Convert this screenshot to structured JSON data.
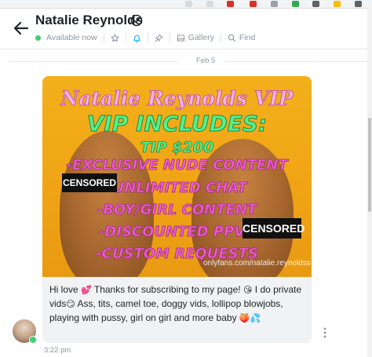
{
  "header": {
    "name": "Natalie Reynolds",
    "status": "Available now",
    "gallery_label": "Gallery",
    "find_label": "Find"
  },
  "conversation": {
    "date": "Feb 5"
  },
  "message": {
    "promo": {
      "title": "Natalie Reynolds VIP",
      "heading": "VIP INCLUDES:",
      "tip": "TIP $200",
      "items": [
        "-EXCLUSIVE NUDE CONTENT",
        "-UNLIMITED CHAT",
        "-BOY/GIRL CONTENT",
        "-DISCOUNTED PPVS",
        "-CUSTOM REQUESTS"
      ],
      "censor_labels": [
        "CENSORED",
        "CENSORED"
      ],
      "watermark": "onlyfans.com/natalie.reynoldss"
    },
    "text_parts": {
      "a": "Hi love",
      "b": "Thanks for subscribing to my page!",
      "c": "I do private vids",
      "d": "Ass, tits, camel toe, doggy vids, lollipop blowjobs, playing with pussy, girl on girl and more baby"
    },
    "emoji": {
      "hearts": "💕",
      "kiss": "😘",
      "smirk": "😏",
      "peach": "🍑",
      "splash": "💦"
    },
    "time": "3:22 pm"
  },
  "icons": {
    "back": "arrow-left-icon",
    "verified": "verified-badge-icon",
    "star": "star-icon",
    "bell": "bell-icon",
    "pin": "pin-icon",
    "gallery": "gallery-icon",
    "search": "search-icon",
    "more": "more-vertical-icon"
  },
  "colors": {
    "accent": "#00aff0",
    "online": "#3ecf72",
    "muted": "#8a96a3",
    "bubble": "#f0f2f4"
  }
}
